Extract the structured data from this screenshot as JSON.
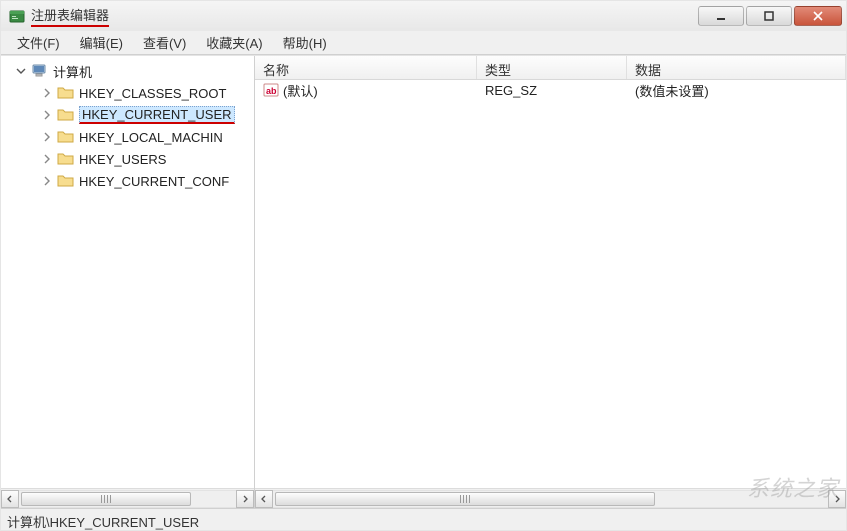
{
  "window": {
    "title": "注册表编辑器"
  },
  "menu": {
    "file": "文件(F)",
    "edit": "编辑(E)",
    "view": "查看(V)",
    "favorites": "收藏夹(A)",
    "help": "帮助(H)"
  },
  "tree": {
    "root": "计算机",
    "items": [
      "HKEY_CLASSES_ROOT",
      "HKEY_CURRENT_USER",
      "HKEY_LOCAL_MACHIN",
      "HKEY_USERS",
      "HKEY_CURRENT_CONF"
    ],
    "selected_index": 1
  },
  "list": {
    "columns": {
      "name": "名称",
      "type": "类型",
      "data": "数据"
    },
    "rows": [
      {
        "name": "(默认)",
        "type": "REG_SZ",
        "data": "(数值未设置)"
      }
    ]
  },
  "statusbar": {
    "path": "计算机\\HKEY_CURRENT_USER"
  },
  "watermark": "系统之家"
}
